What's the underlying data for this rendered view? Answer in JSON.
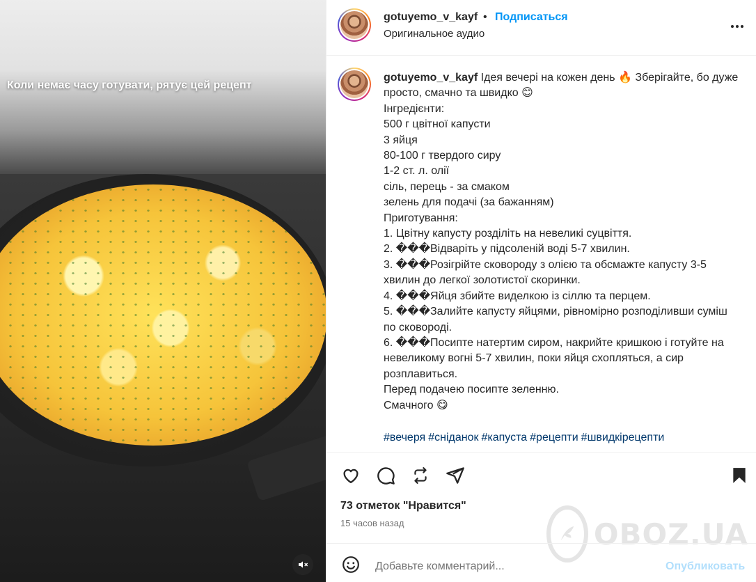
{
  "media": {
    "overlay_text": "Коли немає часу готувати, рятує цей рецепт",
    "mute_icon": "speaker-muted-icon"
  },
  "header": {
    "username": "gotuyemo_v_kayf",
    "separator": "•",
    "follow_label": "Подписаться",
    "audio_label": "Оригинальное аудио",
    "more_icon": "more-horizontal-icon"
  },
  "caption": {
    "username": "gotuyemo_v_kayf",
    "lines": [
      "Ідея вечері на кожен день 🔥 Зберігайте, бо дуже просто, смачно та швидко 😊",
      "Інгредієнти:",
      "500 г цвітної капусти",
      "3 яйця",
      "80-100 г твердого сиру",
      "1-2 ст. л. олії",
      "сіль, перець - за смаком",
      "зелень для подачі (за бажанням)",
      "Приготування:",
      "1. Цвітну капусту розділіть на невеликі суцвіття.",
      "2. ���Відваріть у підсоленій воді 5-7 хвилин.",
      "3. ���Розігрійте сковороду з олією та обсмажте капусту 3-5 хвилин до легкої золотистої скоринки.",
      "4. ���Яйця збийте виделкою із сіллю та перцем.",
      "5. ���Залийте капусту яйцями, рівномірно розподіливши суміш по сковороді.",
      "6. ���Посипте натертим сиром, накрийте кришкою і готуйте на невеликому вогні 5-7 хвилин, поки яйця схопляться, а сир розплавиться.",
      "Перед подачею посипте зеленню.",
      "Смачного 😋"
    ],
    "hashtags": [
      "#вечеря",
      "#сніданок",
      "#капуста",
      "#рецепти",
      "#швидкірецепти"
    ]
  },
  "actions": {
    "like_icon": "heart-icon",
    "comment_icon": "comment-icon",
    "repost_icon": "repost-icon",
    "share_icon": "share-icon",
    "save_icon": "bookmark-icon"
  },
  "likes_text": "73 отметок \"Нравится\"",
  "time_text": "15 часов назад",
  "comment": {
    "emoji_icon": "smiley-icon",
    "placeholder": "Добавьте комментарий...",
    "post_label": "Опубликовать"
  },
  "watermark": {
    "text": "OBOZ.UA"
  }
}
